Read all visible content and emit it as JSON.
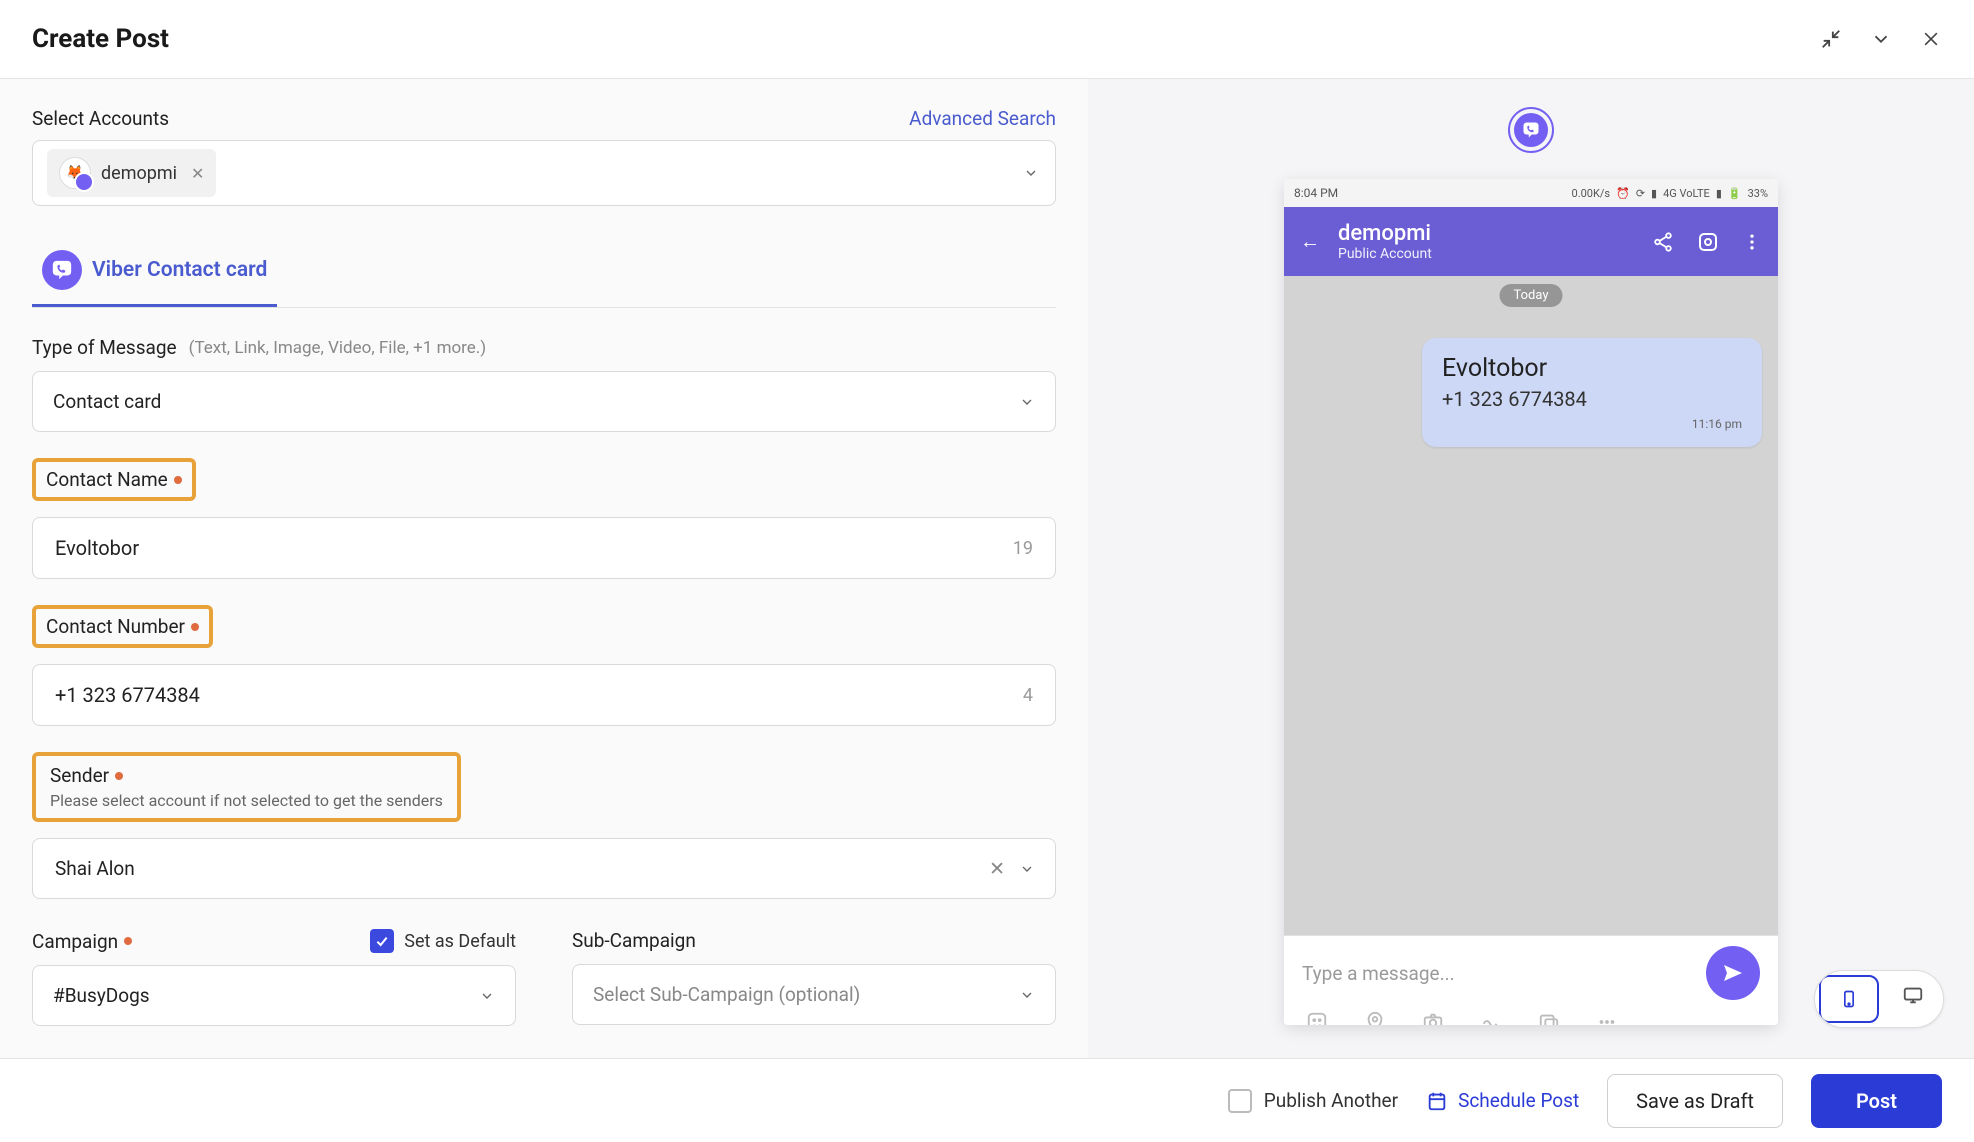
{
  "header": {
    "title": "Create Post"
  },
  "left": {
    "selectAccountsLabel": "Select Accounts",
    "advancedSearch": "Advanced Search",
    "accountChip": "demopmi",
    "tabLabel": "Viber Contact card",
    "typeOfMessage": {
      "label": "Type of Message",
      "hint": "(Text, Link, Image, Video, File, +1 more.)",
      "value": "Contact card"
    },
    "contactName": {
      "label": "Contact Name",
      "value": "Evoltobor",
      "counter": "19"
    },
    "contactNumber": {
      "label": "Contact Number",
      "value": "+1 323 6774384",
      "counter": "4"
    },
    "sender": {
      "label": "Sender",
      "hint": "Please select account if not selected to get the senders",
      "value": "Shai Alon"
    },
    "campaign": {
      "label": "Campaign",
      "setDefaultLabel": "Set as Default",
      "value": "#BusyDogs"
    },
    "subCampaign": {
      "label": "Sub-Campaign",
      "placeholder": "Select Sub-Campaign (optional)"
    }
  },
  "preview": {
    "statusTime": "8:04 PM",
    "statusSpeed": "0.00K/s",
    "statusNet": "4G  VoLTE",
    "statusBatt": "33%",
    "accountName": "demopmi",
    "accountType": "Public Account",
    "todayLabel": "Today",
    "bubbleTitle": "Evoltobor",
    "bubbleSub": "+1 323 6774384",
    "bubbleTime": "11:16 pm",
    "inputPlaceholder": "Type a message..."
  },
  "footer": {
    "publishAnother": "Publish Another",
    "schedule": "Schedule Post",
    "draft": "Save as Draft",
    "post": "Post"
  }
}
